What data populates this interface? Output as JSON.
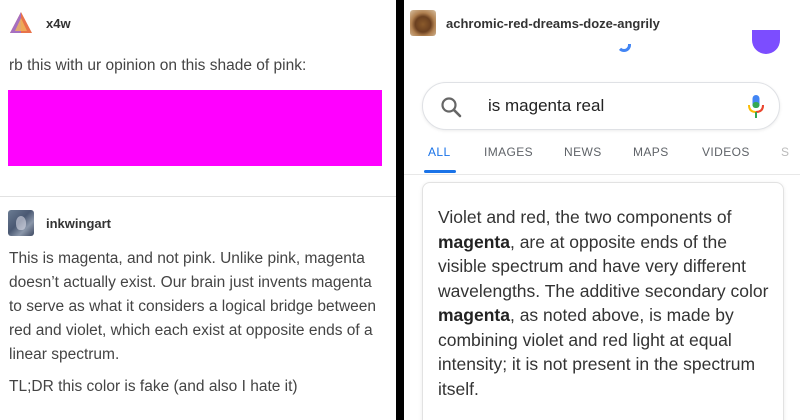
{
  "left": {
    "post1": {
      "username": "x4w",
      "avatar_icon": "triangle-logo-icon",
      "text": "rb this with ur opinion on this shade of pink:",
      "swatch_color": "#ff00ff"
    },
    "post2": {
      "username": "inkwingart",
      "avatar_icon": "artwork-avatar-icon",
      "paragraph": "This is magenta, and not pink. Unlike pink, magenta doesn’t actually exist. Our brain just invents magenta to serve as what it considers a logical bridge between red and violet, which each exist at opposite ends of a linear spectrum.",
      "tldr": "TL;DR this color is fake (and also I hate it)"
    }
  },
  "right": {
    "username": "achromic-red-dreams-doze-angrily",
    "avatar_icon": "dog-avatar-icon",
    "search": {
      "query": "is magenta real"
    },
    "tabs": [
      {
        "label": "ALL",
        "active": true
      },
      {
        "label": "IMAGES",
        "active": false
      },
      {
        "label": "NEWS",
        "active": false
      },
      {
        "label": "MAPS",
        "active": false
      },
      {
        "label": "VIDEOS",
        "active": false
      },
      {
        "label": "S",
        "active": false
      }
    ],
    "snippet": {
      "p1": "Violet and red, the two components of ",
      "b1": "magenta",
      "p2": ", are at opposite ends of the visible spectrum and have very different wavelengths. The additive secondary color ",
      "b2": "magenta",
      "p3": ", as noted above, is made by combining violet and red light at equal intensity; it is not present in the spectrum itself."
    },
    "colors": {
      "accent_blue": "#1a73e8",
      "google_purple": "#7c4dff"
    }
  }
}
